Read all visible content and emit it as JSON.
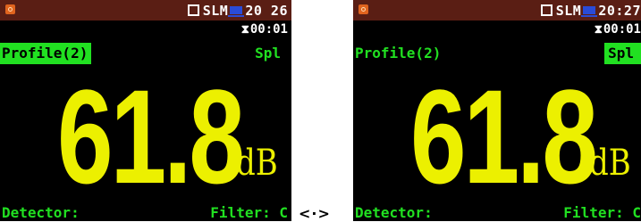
{
  "screens": [
    {
      "status": {
        "mode": "SLM",
        "time": "20 26"
      },
      "timer": "00:01",
      "profile": "Profile(2)",
      "function": "Spl",
      "value": "61.8",
      "unit": "dB",
      "detector_label": "Detector:",
      "filter_label": "Filter: C"
    },
    {
      "status": {
        "mode": "SLM",
        "time": "20:27"
      },
      "timer": "00:01",
      "profile": "Profile(2)",
      "function": "Spl",
      "value": "61.8",
      "unit": "dB",
      "detector_label": "Detector:",
      "filter_label": "Filter: C"
    }
  ],
  "arrow_label": "<·>",
  "colors": {
    "accent_green": "#21e021",
    "reading_yellow": "#ecf000",
    "statusbar": "#5a1e14",
    "battery_blue": "#2a4bd7"
  }
}
